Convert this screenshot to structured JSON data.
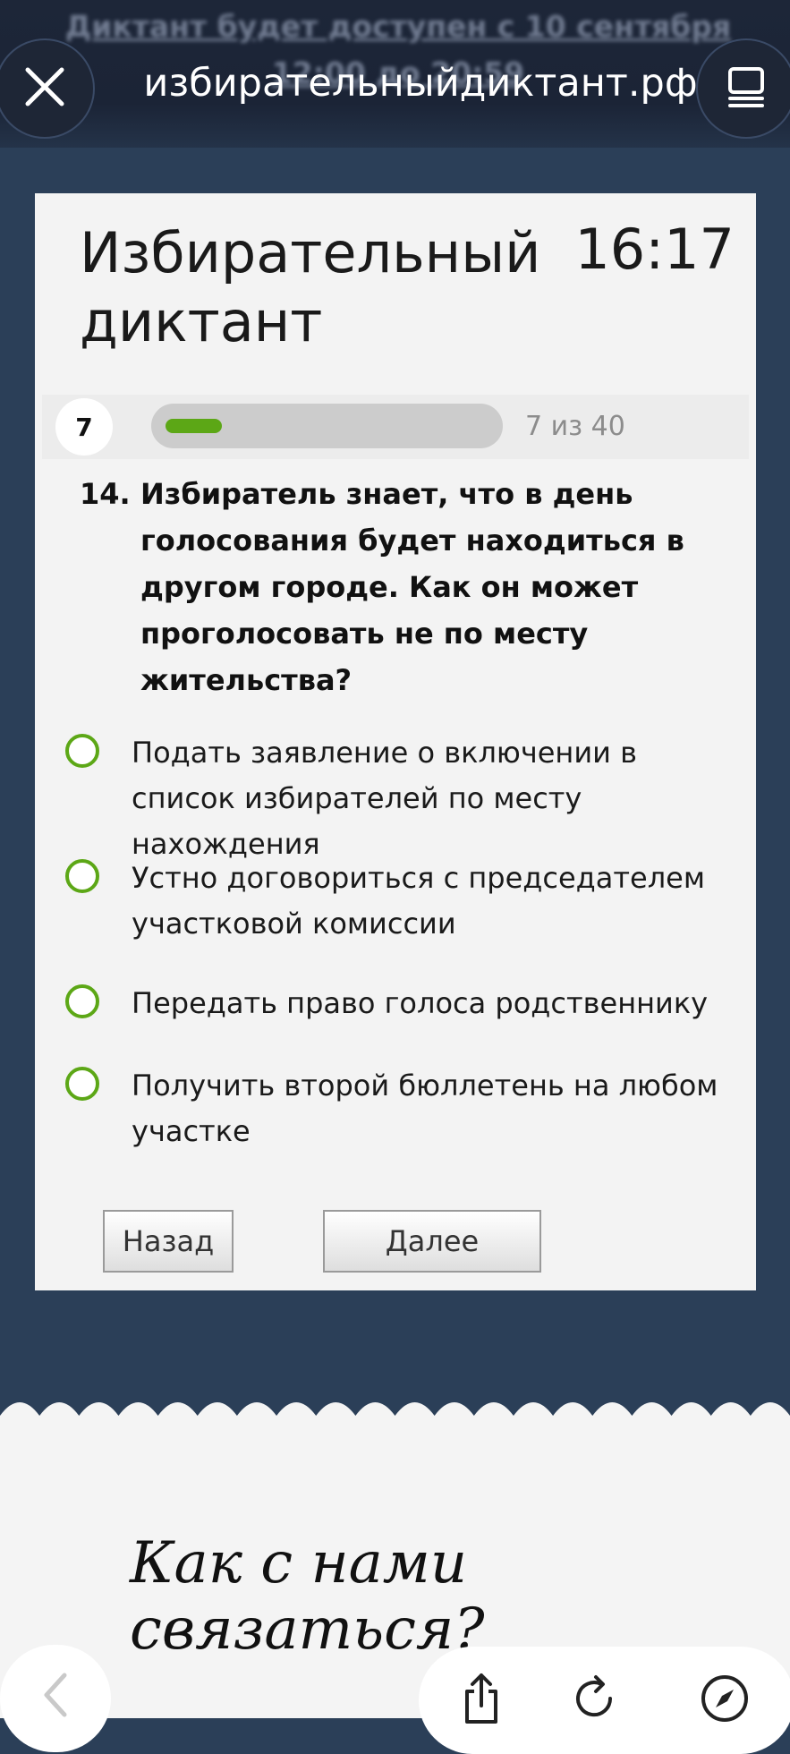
{
  "browser": {
    "banner_text": "Диктант будет доступен с 10 сентября 12:00 до 20:59",
    "url": "избирательныйдиктант.рф",
    "close_icon": "close-icon",
    "tabs_icon": "tabs-icon"
  },
  "quiz": {
    "title": "Избирательный диктант",
    "timer": "16:17",
    "current_index": "7",
    "progress_counter": "7 из 40",
    "progress_fraction": 0.175,
    "question_number": "14.",
    "question_text": "Избиратель знает, что в день голосования будет находиться в другом городе. Как он может проголосовать не по месту жительства?",
    "options": [
      {
        "label": "Подать заявление о включении в список избирателей по месту нахождения"
      },
      {
        "label": "Устно договориться с председателем участковой комиссии"
      },
      {
        "label": "Передать право голоса родственнику"
      },
      {
        "label": "Получить второй бюллетень на любом участке"
      }
    ],
    "back_label": "Назад",
    "next_label": "Далее",
    "accent_color": "#5ca716"
  },
  "footer": {
    "contact_heading": "Как с нами связаться?"
  },
  "nav": {
    "back_icon": "chevron-left-icon",
    "share_icon": "share-icon",
    "reload_icon": "reload-icon",
    "compass_icon": "compass-icon"
  }
}
